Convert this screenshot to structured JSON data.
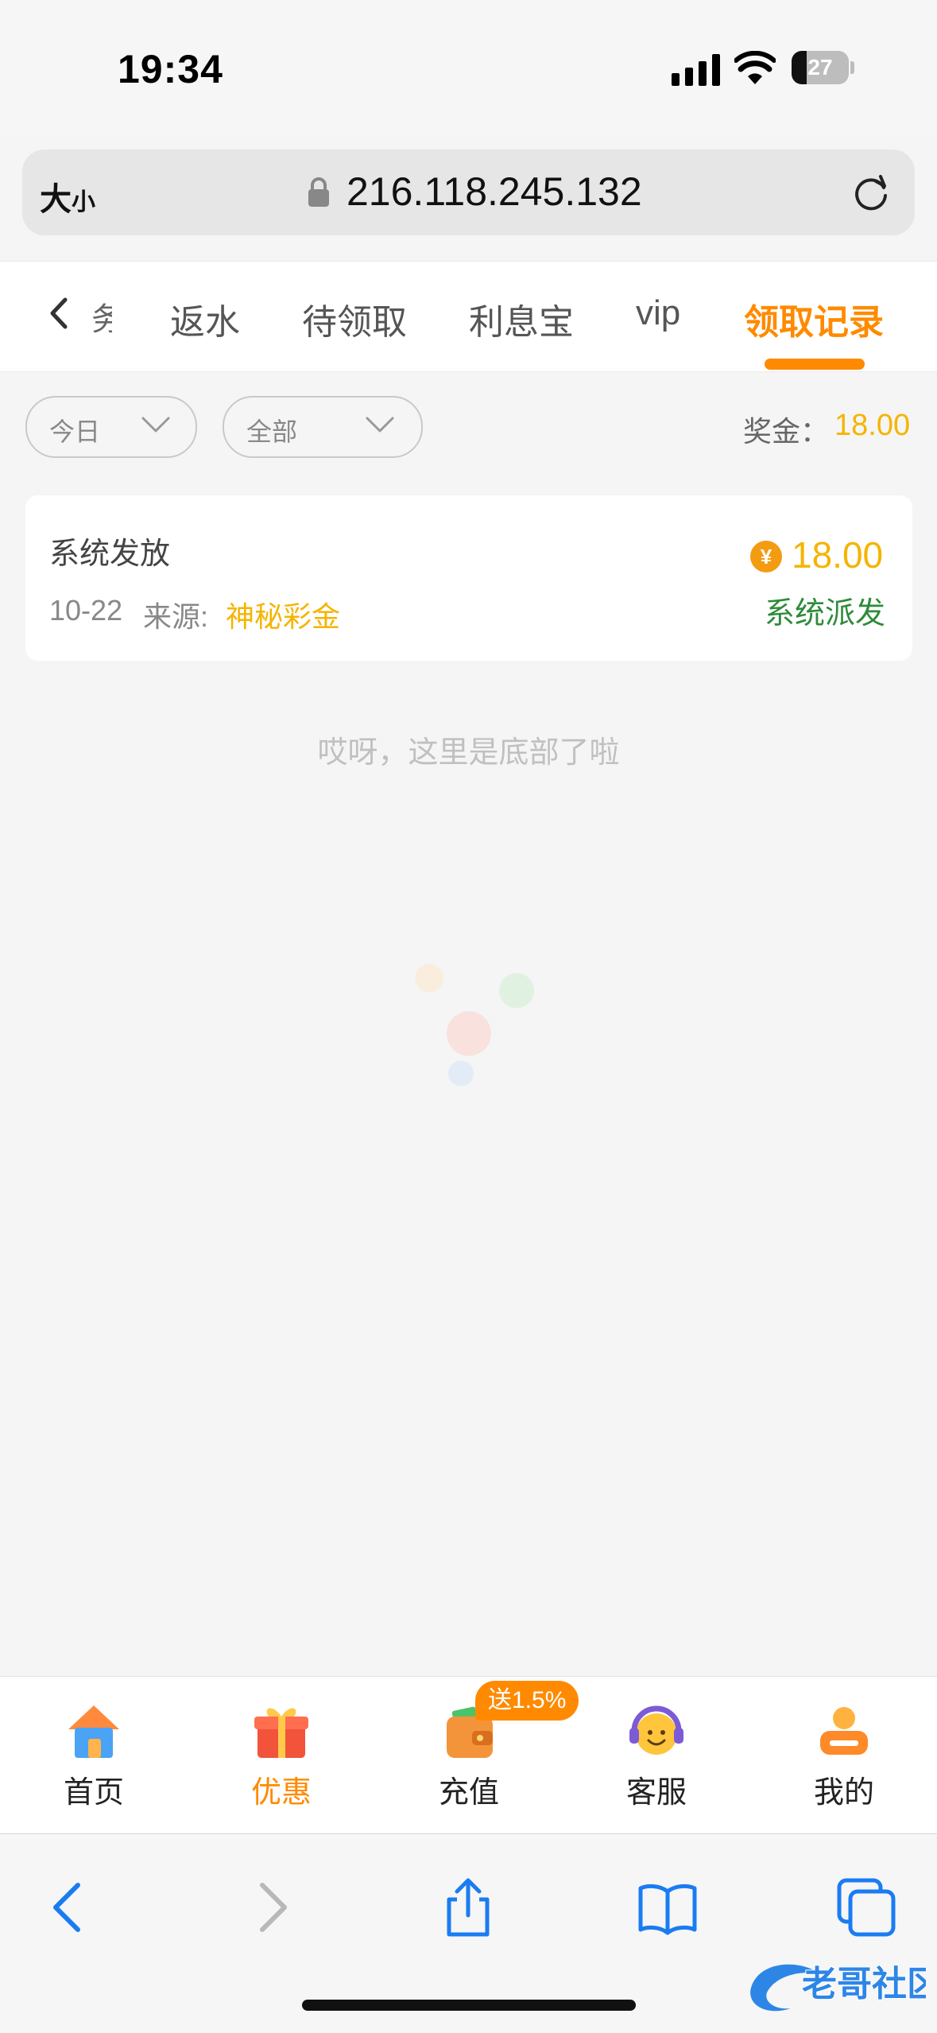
{
  "status_bar": {
    "time": "19:34",
    "battery": "27",
    "battery_level": 0.27
  },
  "browser": {
    "text_size_big": "大",
    "text_size_small": "小",
    "url": "216.118.245.132"
  },
  "tabs": {
    "partial_label": "务",
    "items": [
      {
        "label": "返水"
      },
      {
        "label": "待领取"
      },
      {
        "label": "利息宝"
      },
      {
        "label": "vip"
      },
      {
        "label": "领取记录",
        "active": true
      }
    ]
  },
  "filters": {
    "date": {
      "value": "今日"
    },
    "type": {
      "value": "全部"
    },
    "bonus_label": "奖金：",
    "bonus_value": "18.00"
  },
  "records": [
    {
      "title": "系统发放",
      "date": "10-22",
      "source_label": "来源:",
      "source": "神秘彩金",
      "currency_symbol": "¥",
      "amount": "18.00",
      "status": "系统派发"
    }
  ],
  "end_text": "哎呀，这里是底部了啦",
  "bottom_nav": {
    "recharge_badge": "送1.5%",
    "items": [
      {
        "label": "首页",
        "icon": "home-icon"
      },
      {
        "label": "优惠",
        "icon": "gift-icon",
        "active": true
      },
      {
        "label": "充值",
        "icon": "wallet-icon"
      },
      {
        "label": "客服",
        "icon": "headset-icon"
      },
      {
        "label": "我的",
        "icon": "profile-icon"
      }
    ]
  },
  "watermark": "老哥社区",
  "colors": {
    "accent": "#ff8a00",
    "gold": "#f5b400",
    "success": "#2e8b3a",
    "safari_blue": "#1a7cf2"
  }
}
